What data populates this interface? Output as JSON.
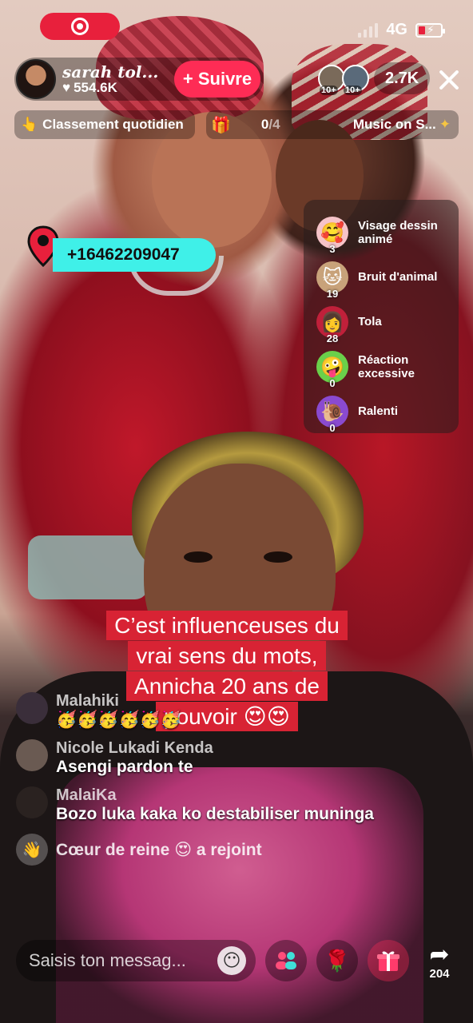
{
  "status": {
    "network": "4G"
  },
  "host": {
    "name": "sarah tol...",
    "likes": "554.6K",
    "follow_label": "+ Suivre"
  },
  "viewers": {
    "badge1": "10+",
    "badge2": "10+",
    "count": "2.7K"
  },
  "ranking": {
    "label": "Classement quotidien",
    "emoji": "👆"
  },
  "music_bar": {
    "progress_done": "0",
    "progress_total": "/4",
    "label": "Music on S..."
  },
  "contact": {
    "phone": "+16462209047"
  },
  "effects": [
    {
      "label": "Visage dessin animé",
      "count": "3",
      "emoji": "🥰",
      "icon": "cartoon-face-icon"
    },
    {
      "label": "Bruit d'animal",
      "count": "19",
      "emoji": "🐱",
      "icon": "cat-icon"
    },
    {
      "label": "Tola",
      "count": "28",
      "emoji": "👩",
      "icon": "tola-icon"
    },
    {
      "label": "Réaction excessive",
      "count": "0",
      "emoji": "🤪",
      "icon": "excessive-reaction-icon"
    },
    {
      "label": "Ralenti",
      "count": "0",
      "emoji": "🐌",
      "icon": "snail-icon"
    }
  ],
  "caption": {
    "line1": "C’est influenceuses du",
    "line2": "vrai sens du mots,",
    "line3": "Annicha 20 ans de",
    "line4": "pouvoir 😍😍"
  },
  "chat": [
    {
      "name": "Malahiki",
      "text": "🥳🥳🥳🥳🥳🥳"
    },
    {
      "name": "Nicole Lukadi Kenda",
      "text": "Asengi pardon te"
    },
    {
      "name": "MalaiKa",
      "text": "Bozo luka kaka ko destabiliser muninga"
    }
  ],
  "joined": {
    "text": "Cœur de reine 😍 a rejoint"
  },
  "bottom": {
    "placeholder": "Saisis ton messag...",
    "emoji": "😶",
    "share_count": "204"
  },
  "colors": {
    "accent": "#fe2c55",
    "phone_pill": "#3ff0e8",
    "caption_bg": "#d82334"
  }
}
